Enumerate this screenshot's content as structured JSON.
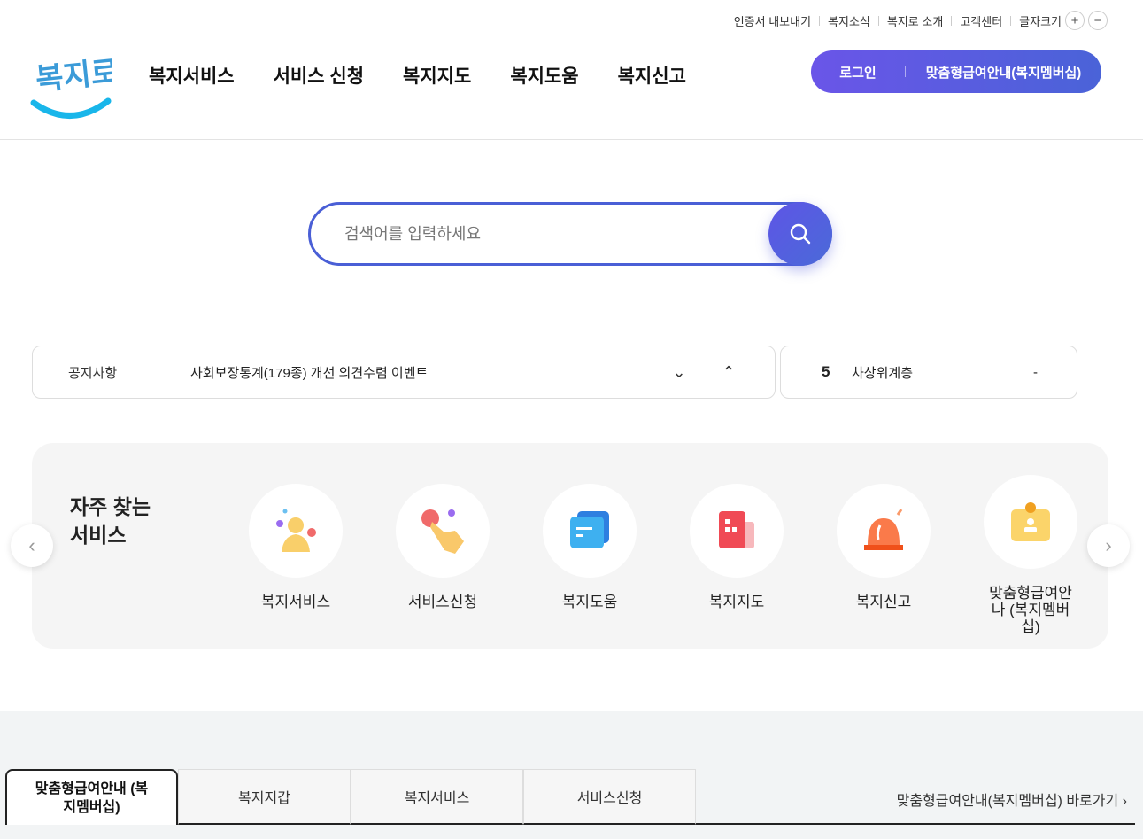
{
  "utility": {
    "links": [
      "인증서 내보내기",
      "복지소식",
      "복지로 소개",
      "고객센터"
    ],
    "font_size_label": "글자크기",
    "plus": "+",
    "minus": "−"
  },
  "logo": {
    "text": "복지로"
  },
  "nav": [
    "복지서비스",
    "서비스 신청",
    "복지지도",
    "복지도움",
    "복지신고"
  ],
  "login": {
    "login": "로그인",
    "membership": "맞춤형급여안내(복지멤버십)"
  },
  "search": {
    "placeholder": "검색어를 입력하세요"
  },
  "notice": {
    "label": "공지사항",
    "text": "사회보장통계(179종) 개선 의견수렴 이벤트"
  },
  "rank": {
    "number": "5",
    "text": "차상위계층",
    "change": "-"
  },
  "favorites": {
    "title_line1": "자주 찾는",
    "title_line2": "서비스",
    "items": [
      {
        "label": "복지서비스",
        "icon": "person-icon"
      },
      {
        "label": "서비스신청",
        "icon": "hand-pointer-icon"
      },
      {
        "label": "복지도움",
        "icon": "message-icon"
      },
      {
        "label": "복지지도",
        "icon": "building-icon"
      },
      {
        "label": "복지신고",
        "icon": "siren-icon"
      },
      {
        "label": "맞춤형급여안나 (복지멤버십)",
        "icon": "id-card-icon"
      }
    ]
  },
  "tabs": [
    {
      "label": "맞춤형급여안내 (복지멤버십)"
    },
    {
      "label": "복지지갑"
    },
    {
      "label": "복지서비스"
    },
    {
      "label": "서비스신청"
    }
  ],
  "goto": "맞춤형급여안내(복지멤버십) 바로가기 ›"
}
